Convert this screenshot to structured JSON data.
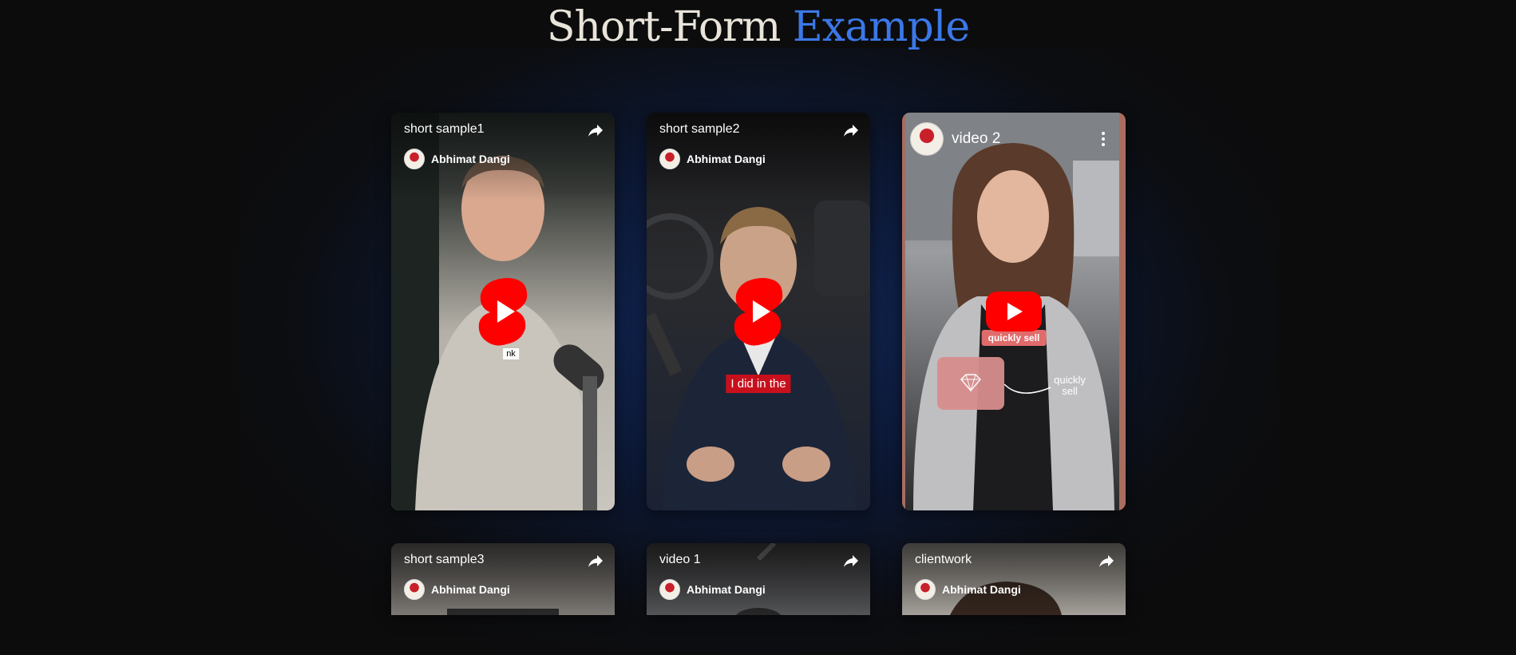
{
  "header": {
    "title_main": "Short-Form",
    "title_accent": "Example"
  },
  "colors": {
    "accent": "#3b78e7",
    "youtube_red": "#ff0000",
    "background": "#0c0c0d"
  },
  "cards": [
    {
      "title": "short sample1",
      "channel": "Abhimat Dangi",
      "player": "shorts",
      "caption": "nk"
    },
    {
      "title": "short sample2",
      "channel": "Abhimat Dangi",
      "player": "shorts",
      "caption": "I did in the"
    },
    {
      "title": "video 2",
      "player": "youtube",
      "overlay_pill": "quickly sell",
      "overlay_text": "quickly sell"
    },
    {
      "title": "short sample3",
      "channel": "Abhimat Dangi",
      "player": "shorts"
    },
    {
      "title": "video 1",
      "channel": "Abhimat Dangi",
      "player": "shorts"
    },
    {
      "title": "clientwork",
      "channel": "Abhimat Dangi",
      "player": "shorts"
    }
  ],
  "icons": {
    "share": "share-icon",
    "play": "shorts-play-icon",
    "menu": "more-vert-icon"
  }
}
